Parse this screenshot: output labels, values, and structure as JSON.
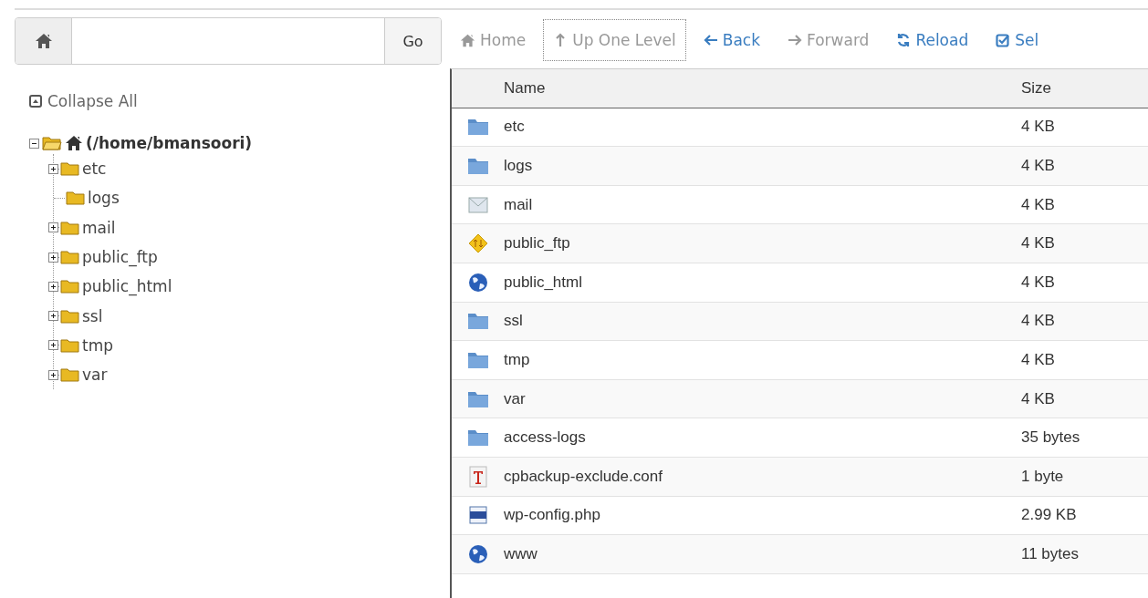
{
  "path_bar": {
    "button": "Go"
  },
  "collapse_all": "Collapse All",
  "tree": {
    "label": "(/home/bmansoori)",
    "expanded": true,
    "children": [
      {
        "label": "etc",
        "expandable": true
      },
      {
        "label": "logs",
        "expandable": false
      },
      {
        "label": "mail",
        "expandable": true
      },
      {
        "label": "public_ftp",
        "expandable": true
      },
      {
        "label": "public_html",
        "expandable": true
      },
      {
        "label": "ssl",
        "expandable": true
      },
      {
        "label": "tmp",
        "expandable": true
      },
      {
        "label": "var",
        "expandable": true
      }
    ]
  },
  "toolbar": [
    {
      "kind": "home",
      "label": "Home",
      "disabled": true,
      "focused": false
    },
    {
      "kind": "up",
      "label": "Up One Level",
      "disabled": true,
      "focused": true
    },
    {
      "kind": "back",
      "label": "Back",
      "disabled": false,
      "focused": false
    },
    {
      "kind": "forward",
      "label": "Forward",
      "disabled": true,
      "focused": false
    },
    {
      "kind": "reload",
      "label": "Reload",
      "disabled": false,
      "focused": false
    },
    {
      "kind": "select",
      "label": "Sel",
      "disabled": false,
      "focused": false
    }
  ],
  "table": {
    "columns": [
      "Name",
      "Size"
    ],
    "rows": [
      {
        "kind": "folder",
        "name": "etc",
        "size": "4 KB"
      },
      {
        "kind": "folder",
        "name": "logs",
        "size": "4 KB"
      },
      {
        "kind": "mail",
        "name": "mail",
        "size": "4 KB"
      },
      {
        "kind": "ftp",
        "name": "public_ftp",
        "size": "4 KB"
      },
      {
        "kind": "web",
        "name": "public_html",
        "size": "4 KB"
      },
      {
        "kind": "folder",
        "name": "ssl",
        "size": "4 KB"
      },
      {
        "kind": "folder",
        "name": "tmp",
        "size": "4 KB"
      },
      {
        "kind": "folder",
        "name": "var",
        "size": "4 KB"
      },
      {
        "kind": "folder",
        "name": "access-logs",
        "size": "35 bytes"
      },
      {
        "kind": "text",
        "name": "cpbackup-exclude.conf",
        "size": "1 byte"
      },
      {
        "kind": "php",
        "name": "wp-config.php",
        "size": "2.99 KB"
      },
      {
        "kind": "web",
        "name": "www",
        "size": "11 bytes"
      }
    ]
  }
}
